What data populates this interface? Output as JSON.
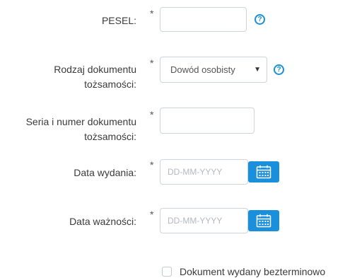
{
  "form": {
    "pesel": {
      "label": "PESEL:",
      "required_mark": "*",
      "value": "",
      "help": "?"
    },
    "document_type": {
      "label_line1": "Rodzaj dokumentu",
      "label_line2": "tożsamości:",
      "required_mark": "*",
      "selected": "Dowód osobisty",
      "arrow": "▼",
      "help": "?"
    },
    "document_number": {
      "label_line1": "Seria i numer dokumentu",
      "label_line2": "tożsamości:",
      "required_mark": "*",
      "value": ""
    },
    "issue_date": {
      "label": "Data wydania:",
      "required_mark": "*",
      "placeholder": "DD-MM-YYYY",
      "value": ""
    },
    "expiry_date": {
      "label": "Data ważności:",
      "required_mark": "*",
      "placeholder": "DD-MM-YYYY",
      "value": ""
    },
    "indefinite": {
      "label": "Dokument wydany bezterminowo",
      "checked": false
    }
  },
  "colors": {
    "accent": "#1a8fdb",
    "border": "#cfd4da",
    "placeholder": "#b5b9bf"
  },
  "icons": {
    "help": "help-circle-icon",
    "calendar": "calendar-icon",
    "dropdown": "chevron-down-icon"
  }
}
